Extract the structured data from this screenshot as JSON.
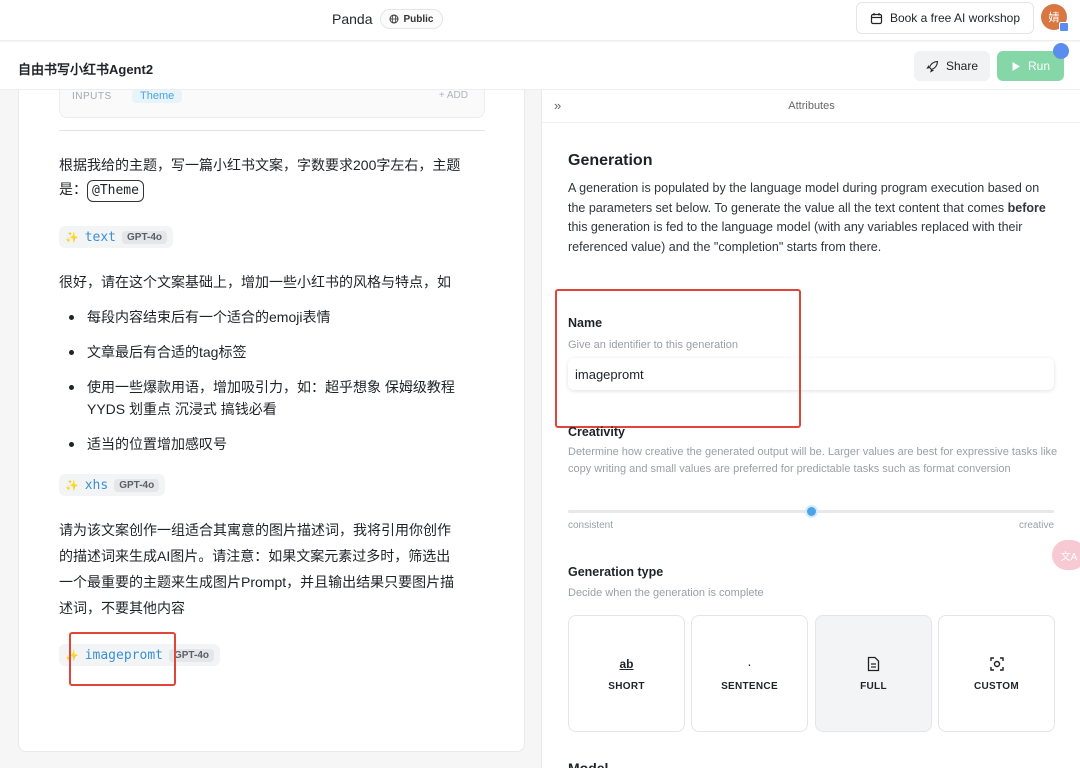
{
  "topbar": {
    "project_name": "Panda",
    "visibility": "Public",
    "workshop_label": "Book a free AI workshop",
    "avatar_initial": "婧"
  },
  "header": {
    "doc_title": "自由书写小红书Agent2",
    "share_label": "Share",
    "run_label": "Run"
  },
  "editor": {
    "inputs_label": "INPUTS",
    "inputs_chip": "Theme",
    "add_label": "+ ADD",
    "prompt1_line1": "根据我给的主题，写一篇小红书文案，字数要求200字左右，主题",
    "prompt1_line2_prefix": "是：",
    "theme_var": "@Theme",
    "gen1": {
      "name": "text",
      "model": "GPT-4o"
    },
    "prompt2": "很好，请在这个文案基础上，增加一些小红书的风格与特点，如",
    "bullets": [
      "每段内容结束后有一个适合的emoji表情",
      "文章最后有合适的tag标签",
      "使用一些爆款用语，增加吸引力，如：超乎想象 保姆级教程 YYDS 划重点 沉浸式 搞钱必看",
      "适当的位置增加感叹号"
    ],
    "gen2": {
      "name": "xhs",
      "model": "GPT-4o"
    },
    "prompt3_lines": [
      "请为该文案创作一组适合其寓意的图片描述词，我将引用你创作",
      "的描述词来生成AI图片。请注意：如果文案元素过多时，筛选出",
      "一个最重要的主题来生成图片Prompt，并且输出结果只要图片描",
      "述词，不要其他内容"
    ],
    "gen3": {
      "name": "imagepromt",
      "model": "GPT-4o"
    }
  },
  "attributes": {
    "panel_title": "Attributes",
    "collapse_icon": "»",
    "generation_heading": "Generation",
    "generation_desc_before": "A generation is populated by the language model during program execution based on the parameters set below. To generate the value all the text content that comes ",
    "generation_desc_bold": "before",
    "generation_desc_after": " this generation is fed to the language model (with any variables replaced with their referenced value) and the \"completion\" starts from there.",
    "name_label": "Name",
    "name_hint": "Give an identifier to this generation",
    "name_value": "imagepromt",
    "creativity_label": "Creativity",
    "creativity_hint": "Determine how creative the generated output will be. Larger values are best for expressive tasks like copy writing and small values are preferred for predictable tasks such as format conversion",
    "creativity_min_label": "consistent",
    "creativity_max_label": "creative",
    "creativity_value": 0.5,
    "gen_type_label": "Generation type",
    "gen_type_hint": "Decide when the generation is complete",
    "gen_types": [
      {
        "label": "SHORT",
        "icon": "ab"
      },
      {
        "label": "SENTENCE",
        "icon": "·"
      },
      {
        "label": "FULL",
        "icon": "document-icon"
      },
      {
        "label": "CUSTOM",
        "icon": "focus-icon"
      }
    ],
    "selected_type": "FULL",
    "next_section_partial": "Model"
  },
  "float_button": "文A",
  "colors": {
    "run_green": "#86d7a8",
    "accent_blue": "#4ba4e6",
    "highlight_red": "#e0453a"
  }
}
